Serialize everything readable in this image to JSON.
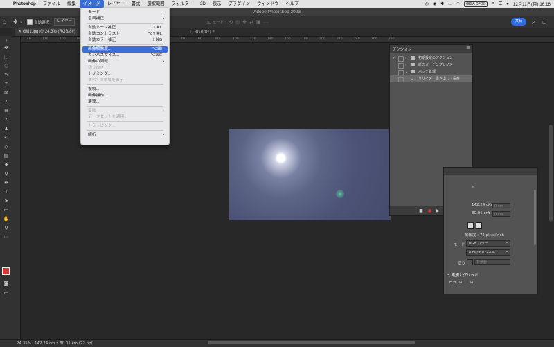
{
  "menubar": {
    "apple_icon": "apple-icon",
    "items": [
      {
        "label": "Photoshop"
      },
      {
        "label": "ファイル"
      },
      {
        "label": "編集"
      },
      {
        "label": "イメージ"
      },
      {
        "label": "レイヤー"
      },
      {
        "label": "書式"
      },
      {
        "label": "選択範囲"
      },
      {
        "label": "フィルター"
      },
      {
        "label": "3D"
      },
      {
        "label": "表示"
      },
      {
        "label": "プラグイン"
      },
      {
        "label": "ウィンドウ"
      },
      {
        "label": "ヘルプ"
      }
    ],
    "status_badge": "GIGA OFOO",
    "clock": "12月11日(月) 16:18"
  },
  "window": {
    "title": "Adobe Photoshop 2023"
  },
  "options": {
    "auto_select": "自動選択 :",
    "layer_select": "レイヤー",
    "mode_3d": "3D モード :",
    "share": "共有"
  },
  "document": {
    "tab_label": "GM1.jpg @ 24.3% (RGB/8#)",
    "tab_suffix": "1, RGB/8*) *"
  },
  "ruler": {
    "ticks": [
      "140",
      "120",
      "100",
      "80",
      "60",
      "40",
      "20",
      "0",
      "20",
      "40",
      "60",
      "80",
      "100",
      "120",
      "140",
      "160",
      "180",
      "200",
      "220",
      "240",
      "260",
      "280"
    ]
  },
  "image_menu": {
    "items": [
      {
        "label": "モード",
        "shortcut": "",
        "arrow": "›",
        "disabled": false
      },
      {
        "label": "色調補正",
        "shortcut": "",
        "arrow": "›",
        "disabled": false
      },
      {
        "label": "自動トーン補正",
        "shortcut": "⇧⌘L",
        "arrow": "",
        "disabled": false
      },
      {
        "label": "自動コントラスト",
        "shortcut": "⌥⇧⌘L",
        "arrow": "",
        "disabled": false
      },
      {
        "label": "自動カラー補正",
        "shortcut": "⇧⌘B",
        "arrow": "",
        "disabled": false
      },
      {
        "label": "画像解像度...",
        "shortcut": "⌥⌘I",
        "arrow": "",
        "disabled": false,
        "highlighted": true
      },
      {
        "label": "カンバスサイズ...",
        "shortcut": "⌥⌘C",
        "arrow": "",
        "disabled": false
      },
      {
        "label": "画像の回転",
        "shortcut": "",
        "arrow": "›",
        "disabled": false
      },
      {
        "label": "切り抜き",
        "shortcut": "",
        "arrow": "",
        "disabled": true
      },
      {
        "label": "トリミング...",
        "shortcut": "",
        "arrow": "",
        "disabled": false
      },
      {
        "label": "すべての領域を表示",
        "shortcut": "",
        "arrow": "",
        "disabled": true
      },
      {
        "label": "複製...",
        "shortcut": "",
        "arrow": "",
        "disabled": false
      },
      {
        "label": "画像操作...",
        "shortcut": "",
        "arrow": "",
        "disabled": false
      },
      {
        "label": "演算...",
        "shortcut": "",
        "arrow": "",
        "disabled": false
      },
      {
        "label": "変数",
        "shortcut": "",
        "arrow": "›",
        "disabled": true
      },
      {
        "label": "データセットを適用...",
        "shortcut": "",
        "arrow": "",
        "disabled": true
      },
      {
        "label": "トラッピング...",
        "shortcut": "",
        "arrow": "",
        "disabled": true
      },
      {
        "label": "解析",
        "shortcut": "",
        "arrow": "›",
        "disabled": false
      }
    ]
  },
  "actions_panel": {
    "title": "アクション",
    "rows": [
      {
        "check": "✓",
        "twisty": "›",
        "label": "初期設定のアクション"
      },
      {
        "check": "",
        "twisty": "›",
        "label": "紙のガーデンプレイス"
      },
      {
        "check": "",
        "twisty": "⌄",
        "label": "バッチ処理"
      },
      {
        "check": "",
        "twisty": "⌄",
        "label": "リサイズ・書き出し・保存"
      }
    ]
  },
  "properties_panel": {
    "width_value": "142.24 cm",
    "height_value": "80.01 cm",
    "x_label": "X",
    "y_label": "Y",
    "x_value": "0 cm",
    "y_value": "0 cm",
    "resolution": "解像度 : 72 pixel/inch",
    "mode_label": "モード",
    "mode_value": "RGB カラー",
    "depth_value": "8 bit/チャンネル",
    "fill_label": "塗り",
    "fill_value": "背景色",
    "section_rulers": "定規とグリッド"
  },
  "status": {
    "zoom": "24.35%",
    "dimensions": "142.24 cm x 80.01 cm (72 ppi)"
  },
  "colors": {
    "accent": "#3b6fd8",
    "foreground_swatch": "#d43a3a",
    "background_swatch": "#ffffff"
  }
}
